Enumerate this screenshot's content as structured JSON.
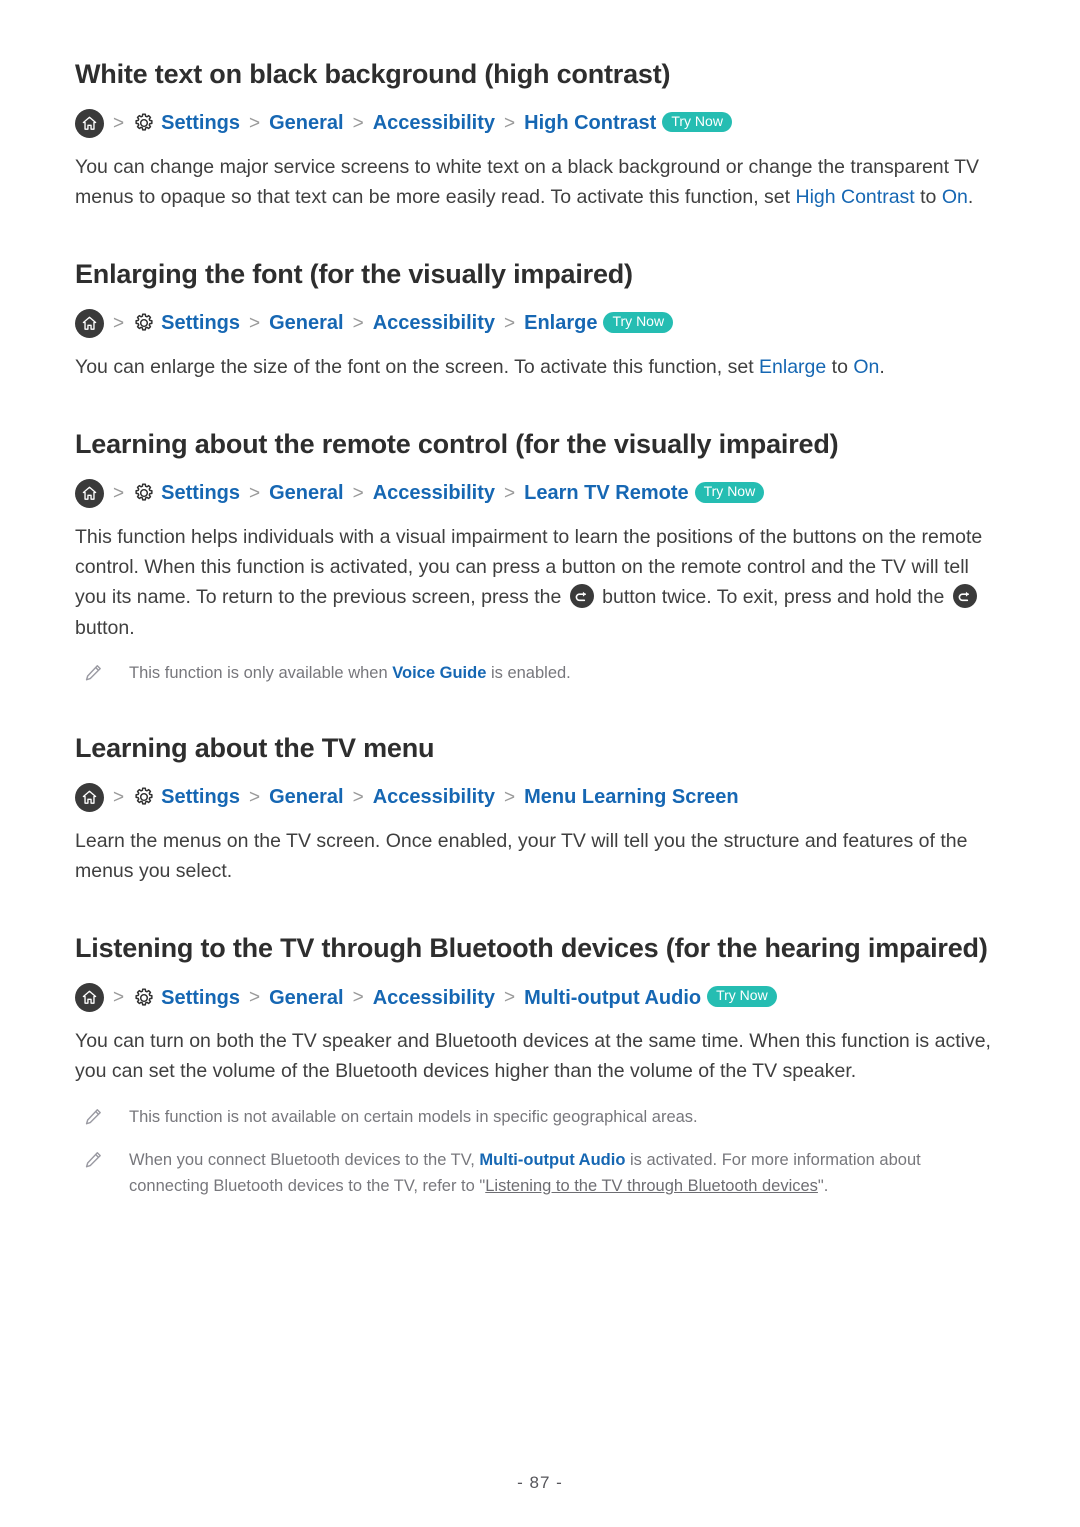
{
  "page": {
    "footer_page_number": "- 87 -",
    "accent_blue": "#1667b3",
    "badge_teal": "#25bdb2",
    "note_gray": "#77777c"
  },
  "common": {
    "home_icon": "home-icon",
    "gear_icon": "gear-icon",
    "chevron": ">",
    "try_now": "Try Now",
    "settings": "Settings",
    "general": "General",
    "accessibility": "Accessibility"
  },
  "sections": [
    {
      "title": "White text on black background (high contrast)",
      "breadcrumb_last": "High Contrast",
      "has_try_now": true,
      "body_parts": [
        {
          "text": "You can change major service screens to white text on a black background or change the transparent TV menus to opaque so that text can be more easily read. To activate this function, set ",
          "style": "plain"
        },
        {
          "text": "High Contrast",
          "style": "blue"
        },
        {
          "text": " to ",
          "style": "plain"
        },
        {
          "text": "On",
          "style": "blue"
        },
        {
          "text": ".",
          "style": "plain"
        }
      ]
    },
    {
      "title": "Enlarging the font (for the visually impaired)",
      "breadcrumb_last": "Enlarge",
      "has_try_now": true,
      "body_parts": [
        {
          "text": "You can enlarge the size of the font on the screen. To activate this function, set ",
          "style": "plain"
        },
        {
          "text": "Enlarge",
          "style": "blue"
        },
        {
          "text": " to ",
          "style": "plain"
        },
        {
          "text": "On",
          "style": "blue"
        },
        {
          "text": ".",
          "style": "plain"
        }
      ]
    },
    {
      "title": "Learning about the remote control (for the visually impaired)",
      "breadcrumb_last": "Learn TV Remote",
      "has_try_now": true,
      "body_parts": [
        {
          "text": "This function helps individuals with a visual impairment to learn the positions of the buttons on the remote control. When this function is activated, you can press a button on the remote control and the TV will tell you its name. To return to the previous screen, press the ",
          "style": "plain"
        },
        {
          "text": "return-icon",
          "style": "icon"
        },
        {
          "text": " button twice. To exit, press and hold the ",
          "style": "plain"
        },
        {
          "text": "return-icon",
          "style": "icon"
        },
        {
          "text": " button.",
          "style": "plain"
        }
      ],
      "notes": [
        [
          {
            "text": "This function is only available when ",
            "style": "plain"
          },
          {
            "text": "Voice Guide",
            "style": "blue-b"
          },
          {
            "text": " is enabled.",
            "style": "plain"
          }
        ]
      ]
    },
    {
      "title": "Learning about the TV menu",
      "breadcrumb_last": "Menu Learning Screen",
      "has_try_now": false,
      "body_parts": [
        {
          "text": "Learn the menus on the TV screen. Once enabled, your TV will tell you the structure and features of the menus you select.",
          "style": "plain"
        }
      ]
    },
    {
      "title": "Listening to the TV through Bluetooth devices (for the hearing impaired)",
      "breadcrumb_last": "Multi-output Audio",
      "has_try_now": true,
      "body_parts": [
        {
          "text": "You can turn on both the TV speaker and Bluetooth devices at the same time. When this function is active, you can set the volume of the Bluetooth devices higher than the volume of the TV speaker.",
          "style": "plain"
        }
      ],
      "notes": [
        [
          {
            "text": "This function is not available on certain models in specific geographical areas.",
            "style": "plain"
          }
        ],
        [
          {
            "text": "When you connect Bluetooth devices to the TV, ",
            "style": "plain"
          },
          {
            "text": "Multi-output Audio",
            "style": "blue-b"
          },
          {
            "text": " is activated. For more information about connecting Bluetooth devices to the TV, refer to \"",
            "style": "plain"
          },
          {
            "text": "Listening to the TV through Bluetooth devices",
            "style": "ulink"
          },
          {
            "text": "\".",
            "style": "plain"
          }
        ]
      ]
    }
  ]
}
